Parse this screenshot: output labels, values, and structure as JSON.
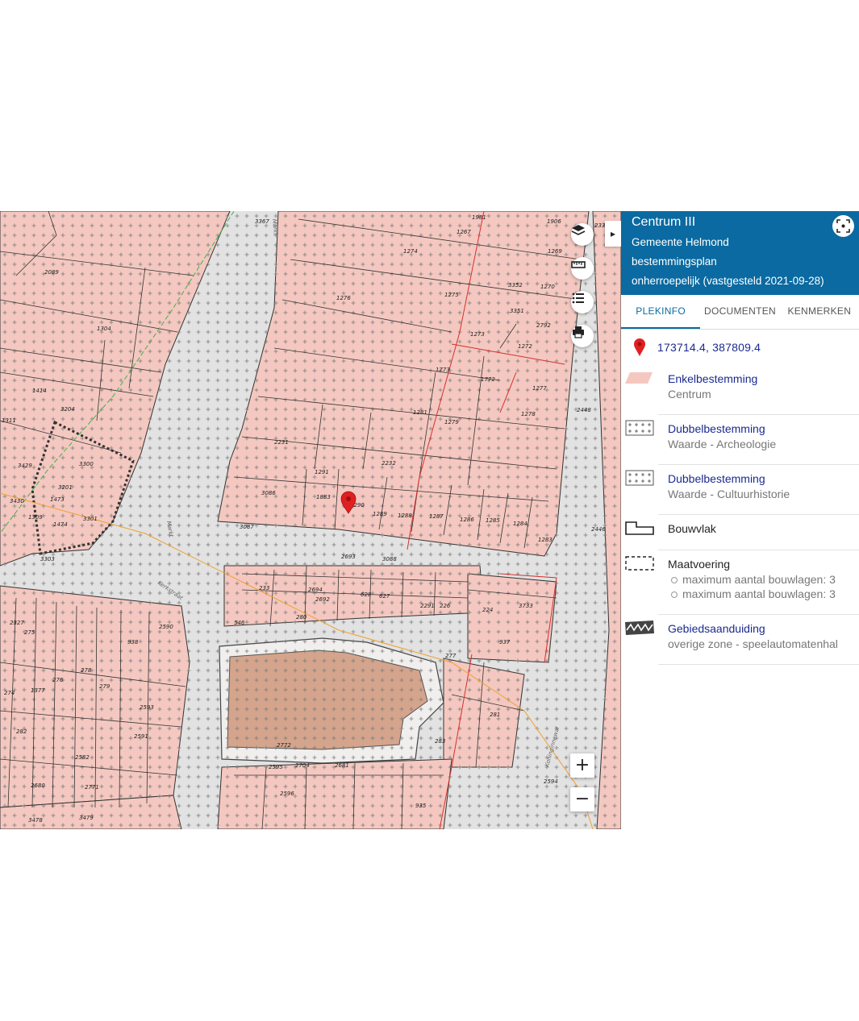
{
  "map": {
    "parcel_labels": [
      {
        "t": "3367"
      },
      {
        "t": "2089"
      },
      {
        "t": "1304"
      },
      {
        "t": "1414"
      },
      {
        "t": "1311"
      },
      {
        "t": "3204"
      },
      {
        "t": "3429"
      },
      {
        "t": "3300"
      },
      {
        "t": "3430"
      },
      {
        "t": "3201"
      },
      {
        "t": "1473"
      },
      {
        "t": "1309"
      },
      {
        "t": "1474"
      },
      {
        "t": "3301"
      },
      {
        "t": "3303"
      },
      {
        "t": "1981"
      },
      {
        "t": "1267"
      },
      {
        "t": "1906"
      },
      {
        "t": "233"
      },
      {
        "t": "1274"
      },
      {
        "t": "1269"
      },
      {
        "t": "1276"
      },
      {
        "t": "1275"
      },
      {
        "t": "3352"
      },
      {
        "t": "1270"
      },
      {
        "t": "3351"
      },
      {
        "t": "2792"
      },
      {
        "t": "1273"
      },
      {
        "t": "1272"
      },
      {
        "t": "1773"
      },
      {
        "t": "1772"
      },
      {
        "t": "1277"
      },
      {
        "t": "1281"
      },
      {
        "t": "1279"
      },
      {
        "t": "1278"
      },
      {
        "t": "2448"
      },
      {
        "t": "2231"
      },
      {
        "t": "2232"
      },
      {
        "t": "1291"
      },
      {
        "t": "3086"
      },
      {
        "t": "1883"
      },
      {
        "t": "1290"
      },
      {
        "t": "1289"
      },
      {
        "t": "1288"
      },
      {
        "t": "1287"
      },
      {
        "t": "1286"
      },
      {
        "t": "1285"
      },
      {
        "t": "1284"
      },
      {
        "t": "1283"
      },
      {
        "t": "2446"
      },
      {
        "t": "3087"
      },
      {
        "t": "2693"
      },
      {
        "t": "3088"
      },
      {
        "t": "233"
      },
      {
        "t": "2694"
      },
      {
        "t": "2692"
      },
      {
        "t": "628"
      },
      {
        "t": "627"
      },
      {
        "t": "2291"
      },
      {
        "t": "226"
      },
      {
        "t": "224"
      },
      {
        "t": "3733"
      },
      {
        "t": "2327"
      },
      {
        "t": "2590"
      },
      {
        "t": "546"
      },
      {
        "t": "280"
      },
      {
        "t": "275"
      },
      {
        "t": "938"
      },
      {
        "t": "937"
      },
      {
        "t": "277"
      },
      {
        "t": "278"
      },
      {
        "t": "276"
      },
      {
        "t": "279"
      },
      {
        "t": "1377"
      },
      {
        "t": "274"
      },
      {
        "t": "2593"
      },
      {
        "t": "281"
      },
      {
        "t": "282"
      },
      {
        "t": "2591"
      },
      {
        "t": "2772"
      },
      {
        "t": "283"
      },
      {
        "t": "2582"
      },
      {
        "t": "2595"
      },
      {
        "t": "2704"
      },
      {
        "t": "2681"
      },
      {
        "t": "2680"
      },
      {
        "t": "2771"
      },
      {
        "t": "2596"
      },
      {
        "t": "2594"
      },
      {
        "t": "935"
      },
      {
        "t": "3478"
      },
      {
        "t": "3479"
      }
    ],
    "street_labels": [
      {
        "t": "Markt"
      },
      {
        "t": "Markt"
      },
      {
        "t": "Kerkstraat"
      },
      {
        "t": "Koninginnewal"
      }
    ],
    "controls": {
      "zoom_in_label": "+",
      "zoom_out_label": "−",
      "layers_icon": "layers-icon",
      "ruler_icon": "ruler-icon",
      "legend_icon": "list-icon",
      "print_icon": "print-icon",
      "collapse_glyph": "▸"
    }
  },
  "panel": {
    "title": "Centrum III",
    "municipality": "Gemeente Helmond",
    "plan_type": "bestemmingsplan",
    "status": "onherroepelijk (vastgesteld 2021-09-28)",
    "tabs": [
      {
        "label": "PLEKINFO",
        "active": true
      },
      {
        "label": "DOCUMENTEN",
        "active": false
      },
      {
        "label": "KENMERKEN",
        "active": false
      }
    ],
    "coordinates": "173714.4, 387809.4",
    "legend": [
      {
        "title": "Enkelbestemming",
        "subtitle": "Centrum",
        "symbol": "pink-fill"
      },
      {
        "title": "Dubbelbestemming",
        "subtitle": "Waarde - Archeologie",
        "symbol": "cross-hatch"
      },
      {
        "title": "Dubbelbestemming",
        "subtitle": "Waarde - Cultuurhistorie",
        "symbol": "cross-hatch"
      },
      {
        "title": "Bouwvlak",
        "symbol": "building-outline"
      },
      {
        "title": "Maatvoering",
        "items": [
          "maximum aantal bouwlagen: 3",
          "maximum aantal bouwlagen: 3"
        ],
        "symbol": "dashed-box"
      },
      {
        "title": "Gebiedsaanduiding",
        "subtitle": "overige zone - speelautomatenhal",
        "symbol": "zigzag-band"
      }
    ]
  },
  "colors": {
    "header_bg": "#0a6aa1",
    "pink_zone": "#f4c6bd",
    "link_blue": "#1a2a8f",
    "marker_red": "#e02020"
  }
}
